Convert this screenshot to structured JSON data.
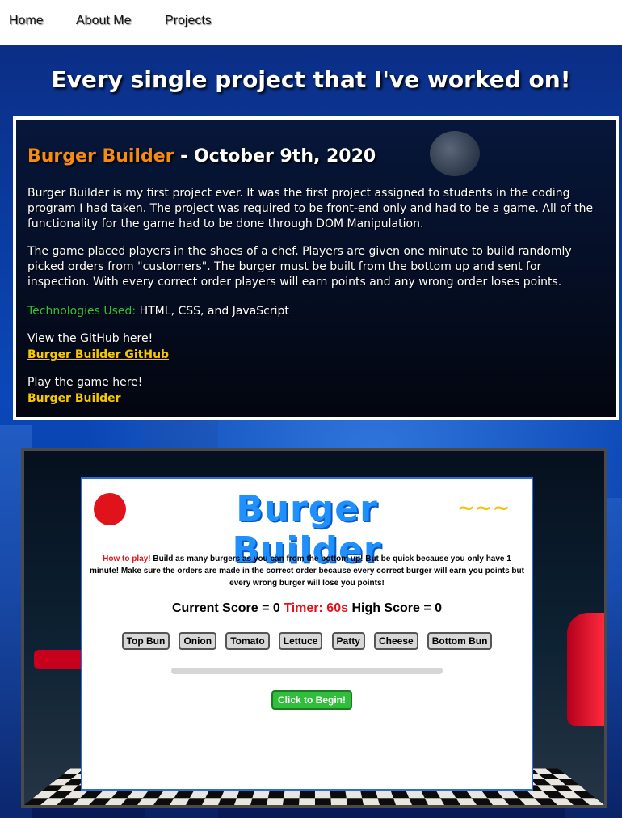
{
  "nav": {
    "items": [
      {
        "label": "Home"
      },
      {
        "label": "About Me"
      },
      {
        "label": "Projects"
      }
    ]
  },
  "page": {
    "headline": "Every single project that I've worked on!"
  },
  "project": {
    "name": "Burger Builder",
    "date": " - October 9th, 2020",
    "para1": "Burger Builder is my first project ever. It was the first project assigned to students in the coding program I had taken. The project was required to be front-end only and had to be a game. All of the functionality for the game had to be done through DOM Manipulation.",
    "para2": "The game placed players in the shoes of a chef. Players are given one minute to build randomly picked orders from \"customers\". The burger must be built from the bottom up and sent for inspection. With every correct order players will earn points and any wrong order loses points.",
    "tech_label": "Technologies Used:",
    "tech_list": " HTML, CSS, and JavaScript",
    "github_text": "View the GitHub here!",
    "github_link": "Burger Builder GitHub",
    "play_text": "Play the game here!",
    "play_link": "Burger Builder"
  },
  "game_preview": {
    "logo": "Burger Builder",
    "howto_label": "How to play!",
    "howto_text": " Build as many burgers as you can from the bottom up! But be quick because you only have 1 minute! Make sure the orders are made in the correct order because every correct burger will earn you points but every wrong burger will lose you points!",
    "score_label": "Current Score = 0",
    "timer_label": "Timer: 60s",
    "high_score_label": "High Score = 0",
    "ingredients": [
      "Top Bun",
      "Onion",
      "Tomato",
      "Lettuce",
      "Patty",
      "Cheese",
      "Bottom Bun"
    ],
    "begin_label": "Click to Begin!"
  },
  "colors": {
    "accent_orange": "#f58b10",
    "tech_green": "#33c233",
    "link_yellow": "#f7c800",
    "logo_blue": "#1e90ff",
    "timer_red": "#e0131b"
  }
}
